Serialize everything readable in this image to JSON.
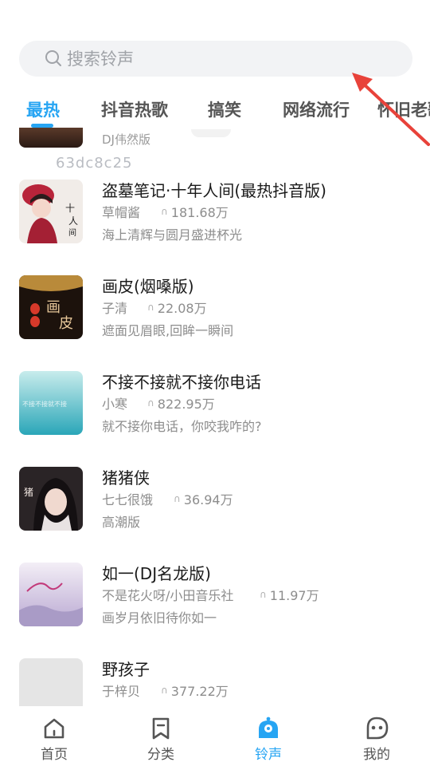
{
  "search": {
    "placeholder": "搜索铃声",
    "icon": "search-icon"
  },
  "tabs": [
    {
      "label": "最热",
      "active": true
    },
    {
      "label": "抖音热歌",
      "active": false
    },
    {
      "label": "搞笑",
      "active": false
    },
    {
      "label": "网络流行",
      "active": false
    },
    {
      "label": "怀旧老歌",
      "active": false
    }
  ],
  "list": {
    "partial_item_subtitle": "DJ伟然版",
    "id_text": "63dc8c25",
    "items": [
      {
        "title": "盗墓笔记·十年人间(最热抖音版)",
        "artist": "草帽酱",
        "plays": "181.68万",
        "desc": "海上清辉与圆月盛进杯光"
      },
      {
        "title": "画皮(烟嗓版)",
        "artist": "子清",
        "plays": "22.08万",
        "desc": "遮面见眉眼,回眸一瞬间"
      },
      {
        "title": "不接不接就不接你电话",
        "artist": "小寒",
        "plays": "822.95万",
        "desc": "就不接你电话，你咬我咋的?"
      },
      {
        "title": "猪猪侠",
        "artist": "七七很饿",
        "plays": "36.94万",
        "desc": "高潮版"
      },
      {
        "title": "如一(DJ名龙版)",
        "artist": "不是花火呀/小田音乐社",
        "plays": "11.97万",
        "desc": "画岁月依旧待你如一"
      },
      {
        "title": "野孩子",
        "artist": "于梓贝",
        "plays": "377.22万",
        "desc": ""
      }
    ]
  },
  "nav": {
    "items": [
      {
        "label": "首页",
        "icon": "home-icon",
        "active": false
      },
      {
        "label": "分类",
        "icon": "bookmark-icon",
        "active": false
      },
      {
        "label": "铃声",
        "icon": "bell-icon",
        "active": true
      },
      {
        "label": "我的",
        "icon": "profile-face-icon",
        "active": false
      }
    ]
  },
  "colors": {
    "accent": "#27a5f3",
    "annotation_arrow": "#e8423a"
  }
}
